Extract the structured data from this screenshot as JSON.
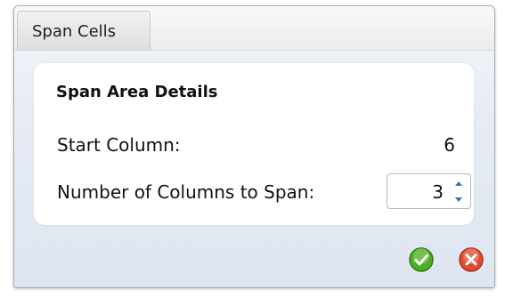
{
  "dialog": {
    "title": "Span Cells",
    "section_heading": "Span Area Details",
    "start_column": {
      "label": "Start Column:",
      "value": "6"
    },
    "columns_to_span": {
      "label": "Number of Columns to Span:",
      "value": "3"
    },
    "icons": {
      "spin_up": "chevron-up-icon",
      "spin_down": "chevron-down-icon",
      "ok": "check-icon",
      "cancel": "close-icon"
    },
    "colors": {
      "ok": "#4caf24",
      "cancel": "#e04a2f"
    }
  }
}
